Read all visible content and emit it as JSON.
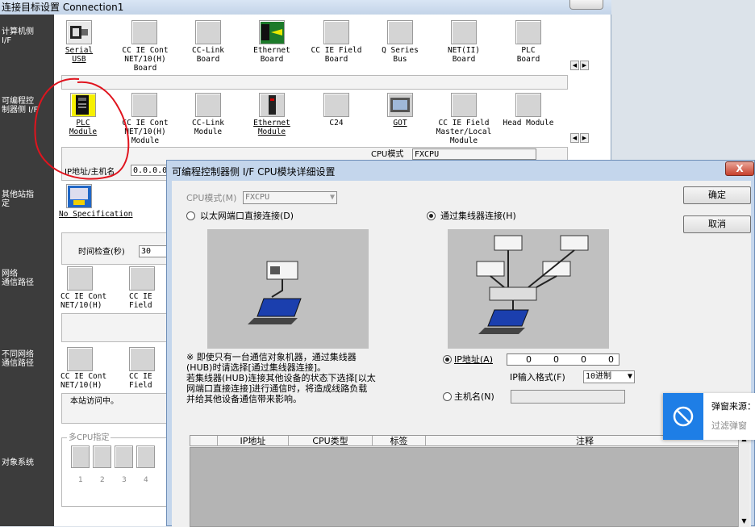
{
  "bg": {
    "title": "连接目标设置 Connection1",
    "side": {
      "pc_if": "计算机侧\nI/F",
      "plc_if": "可编程控\n制器侧 I/F",
      "other_station": "其他站指\n定",
      "network_route": "网络\n通信路径",
      "diff_network": "不同网络\n通信路径",
      "target_system": "对象系统"
    },
    "pc_tiles": [
      "Serial\nUSB",
      "CC IE Cont\nNET/10(H)\nBoard",
      "CC-Link\nBoard",
      "Ethernet\nBoard",
      "CC IE Field\nBoard",
      "Q Series\nBus",
      "NET(II)\nBoard",
      "PLC\nBoard"
    ],
    "plc_tiles": [
      "PLC\nModule",
      "CC IE Cont\nNET/10(H)\nModule",
      "CC-Link\nModule",
      "Ethernet\nModule",
      "C24",
      "GOT",
      "CC IE Field\nMaster/Local\nModule",
      "Head Module"
    ],
    "cpu_mode_label": "CPU模式",
    "cpu_mode_value": "FXCPU",
    "ip_label": "IP地址/主机名",
    "ip_value": "0.0.0.0",
    "no_spec": "No Specification",
    "time_check_label": "时间检查(秒)",
    "time_check_value": "30",
    "net_tiles": [
      "CC IE Cont\nNET/10(H)",
      "CC IE\nField"
    ],
    "diff_tiles": [
      "CC IE Cont\nNET/10(H)",
      "CC IE\nField"
    ],
    "station_access": "本站访问中。",
    "multi_cpu": "多CPU指定",
    "cpu_numbers": [
      "1",
      "2",
      "3",
      "4"
    ]
  },
  "dialog": {
    "title": "可编程控制器侧 I/F CPU模块详细设置",
    "close": "X",
    "cpu_mode_label": "CPU模式(M)",
    "cpu_mode_value": "FXCPU",
    "ok": "确定",
    "cancel": "取消",
    "direct_connect": "以太网端口直接连接(D)",
    "hub_connect": "通过集线器连接(H)",
    "note": "※ 即使只有一台通信对象机器，通过集线器\n(HUB)时请选择[通过集线器连接]。\n若集线器(HUB)连接其他设备的状态下选择[以太\n网端口直接连接]进行通信时，将造成线路负载\n并给其他设备通信带来影响。",
    "ip_label": "IP地址(A)",
    "ip_values": [
      "0",
      "0",
      "0",
      "0"
    ],
    "ip_format_label": "IP输入格式(F)",
    "ip_format_value": "10进制",
    "hostname_label": "主机名(N)",
    "table_headers": [
      "IP地址",
      "CPU类型",
      "标签",
      "注释"
    ]
  },
  "toast": {
    "title": "弹窗来源：",
    "subtitle": "过滤弹窗"
  },
  "colors": {
    "dialog_bg": "#c4d6ec",
    "close_red": "#c7402c",
    "toast_blue": "#1e7ee6",
    "annotation_red": "#e0141e"
  }
}
